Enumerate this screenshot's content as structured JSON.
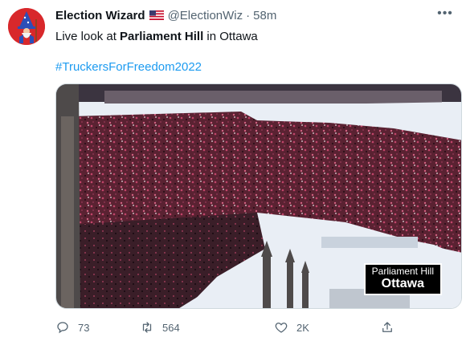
{
  "author": {
    "display_name": "Election Wizard",
    "handle": "@ElectionWiz",
    "separator": "·",
    "time": "58m",
    "avatar_icon": "wizard-avatar-icon",
    "flag_icon": "us-flag-icon"
  },
  "tweet": {
    "text_prefix": "Live look at ",
    "text_bold": "Parliament Hill",
    "text_suffix": " in Ottawa",
    "hashtag": "#TruckersForFreedom2022"
  },
  "media": {
    "caption_line1": "Parliament Hill",
    "caption_line2": "Ottawa"
  },
  "actions": {
    "reply_count": "73",
    "retweet_count": "564",
    "like_count": "2K",
    "share_label": ""
  },
  "colors": {
    "link": "#1d9bf0",
    "muted": "#536471",
    "avatar_bg": "#d8282b",
    "crowd": "#5a2232",
    "snow": "#e9eef5"
  }
}
